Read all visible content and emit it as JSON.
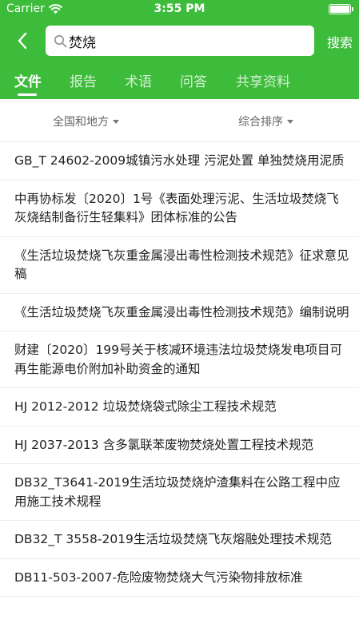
{
  "status_bar": {
    "carrier": "Carrier",
    "time": "3:55 PM"
  },
  "search": {
    "query": "焚烧",
    "action_label": "搜索"
  },
  "tabs": [
    {
      "label": "文件"
    },
    {
      "label": "报告"
    },
    {
      "label": "术语"
    },
    {
      "label": "问答"
    },
    {
      "label": "共享资料"
    }
  ],
  "active_tab": "文件",
  "filters": {
    "region": "全国和地方",
    "sort": "综合排序"
  },
  "results": [
    {
      "title": "GB_T 24602-2009城镇污水处理 污泥处置 单独焚烧用泥质"
    },
    {
      "title": "中再协标发〔2020〕1号《表面处理污泥、生活垃圾焚烧飞灰烧结制备衍生轻集料》团体标准的公告"
    },
    {
      "title": "《生活垃圾焚烧飞灰重金属浸出毒性检测技术规范》征求意见稿"
    },
    {
      "title": "《生活垃圾焚烧飞灰重金属浸出毒性检测技术规范》编制说明"
    },
    {
      "title": "财建〔2020〕199号关于核减环境违法垃圾焚烧发电项目可再生能源电价附加补助资金的通知"
    },
    {
      "title": "HJ 2012-2012 垃圾焚烧袋式除尘工程技术规范"
    },
    {
      "title": "HJ 2037-2013 含多氯联苯废物焚烧处置工程技术规范"
    },
    {
      "title": "DB32_T3641-2019生活垃圾焚烧炉渣集料在公路工程中应用施工技术规程"
    },
    {
      "title": "DB32_T 3558-2019生活垃圾焚烧飞灰熔融处理技术规范"
    },
    {
      "title": "DB11-503-2007-危险废物焚烧大气污染物排放标准"
    }
  ]
}
